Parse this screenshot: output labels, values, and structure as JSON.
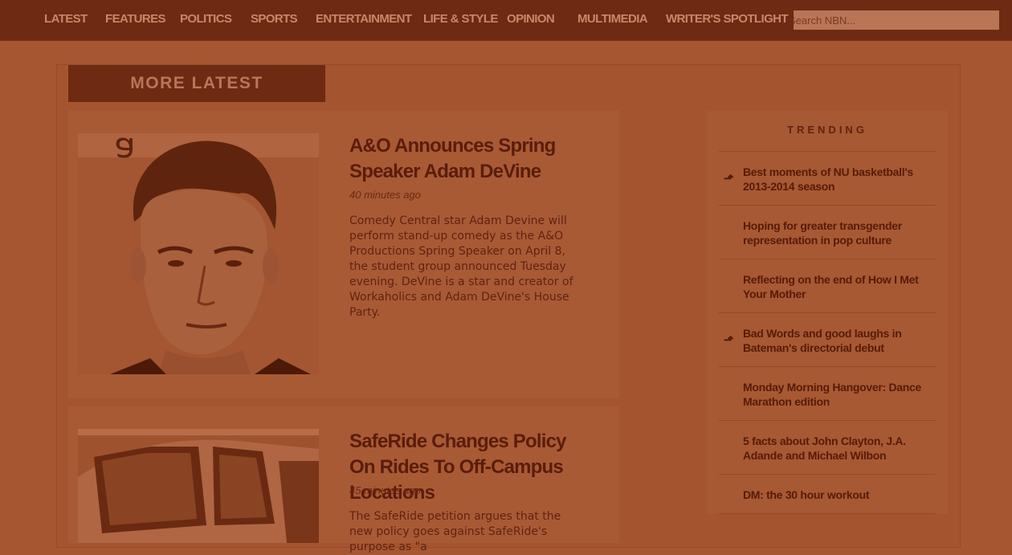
{
  "nav": {
    "items": [
      "LATEST",
      "FEATURES",
      "POLITICS",
      "SPORTS",
      "ENTERTAINMENT",
      "LIFE & STYLE",
      "OPINION",
      "MULTIMEDIA",
      "WRITER'S SPOTLIGHT"
    ],
    "search_placeholder": "Search NBN..."
  },
  "section": {
    "title": "MORE LATEST"
  },
  "articles": [
    {
      "headline": "A&O Announces Spring Speaker Adam DeVine",
      "timestamp": "40 minutes ago",
      "excerpt": "Comedy Central star Adam Devine will perform stand-up comedy as the A&O Productions Spring Speaker on April 8, the student group announced Tuesday evening. DeVine is a star and creator of Workaholics and Adam DeVine's House Party.",
      "image": "portrait-photo"
    },
    {
      "headline": "SafeRide Changes Policy On Rides To Off-Campus Locations",
      "timestamp": "45 minutes ago",
      "excerpt": "The SafeRide petition argues that the new policy goes against SafeRide's purpose as \"a",
      "image": "car-photo"
    }
  ],
  "trending": {
    "title": "TRENDING",
    "items": [
      {
        "title": "Best moments of NU basketball's 2013-2014 season",
        "arrow": true
      },
      {
        "title": "Hoping for greater transgender representation in pop culture",
        "arrow": false
      },
      {
        "title": "Reflecting on the end of How I Met Your Mother",
        "arrow": false
      },
      {
        "title": "Bad Words and good laughs in Bateman's directorial debut",
        "arrow": true
      },
      {
        "title": "Monday Morning Hangover: Dance Marathon edition",
        "arrow": false
      },
      {
        "title": "5 facts about John Clayton, J.A. Adande and Michael Wilbon",
        "arrow": false
      },
      {
        "title": "DM: the 30 hour workout",
        "arrow": false
      }
    ]
  },
  "colors": {
    "overlay": "#a65732",
    "nav_bg": "#6e2a12",
    "headline": "#5a1d0a"
  }
}
